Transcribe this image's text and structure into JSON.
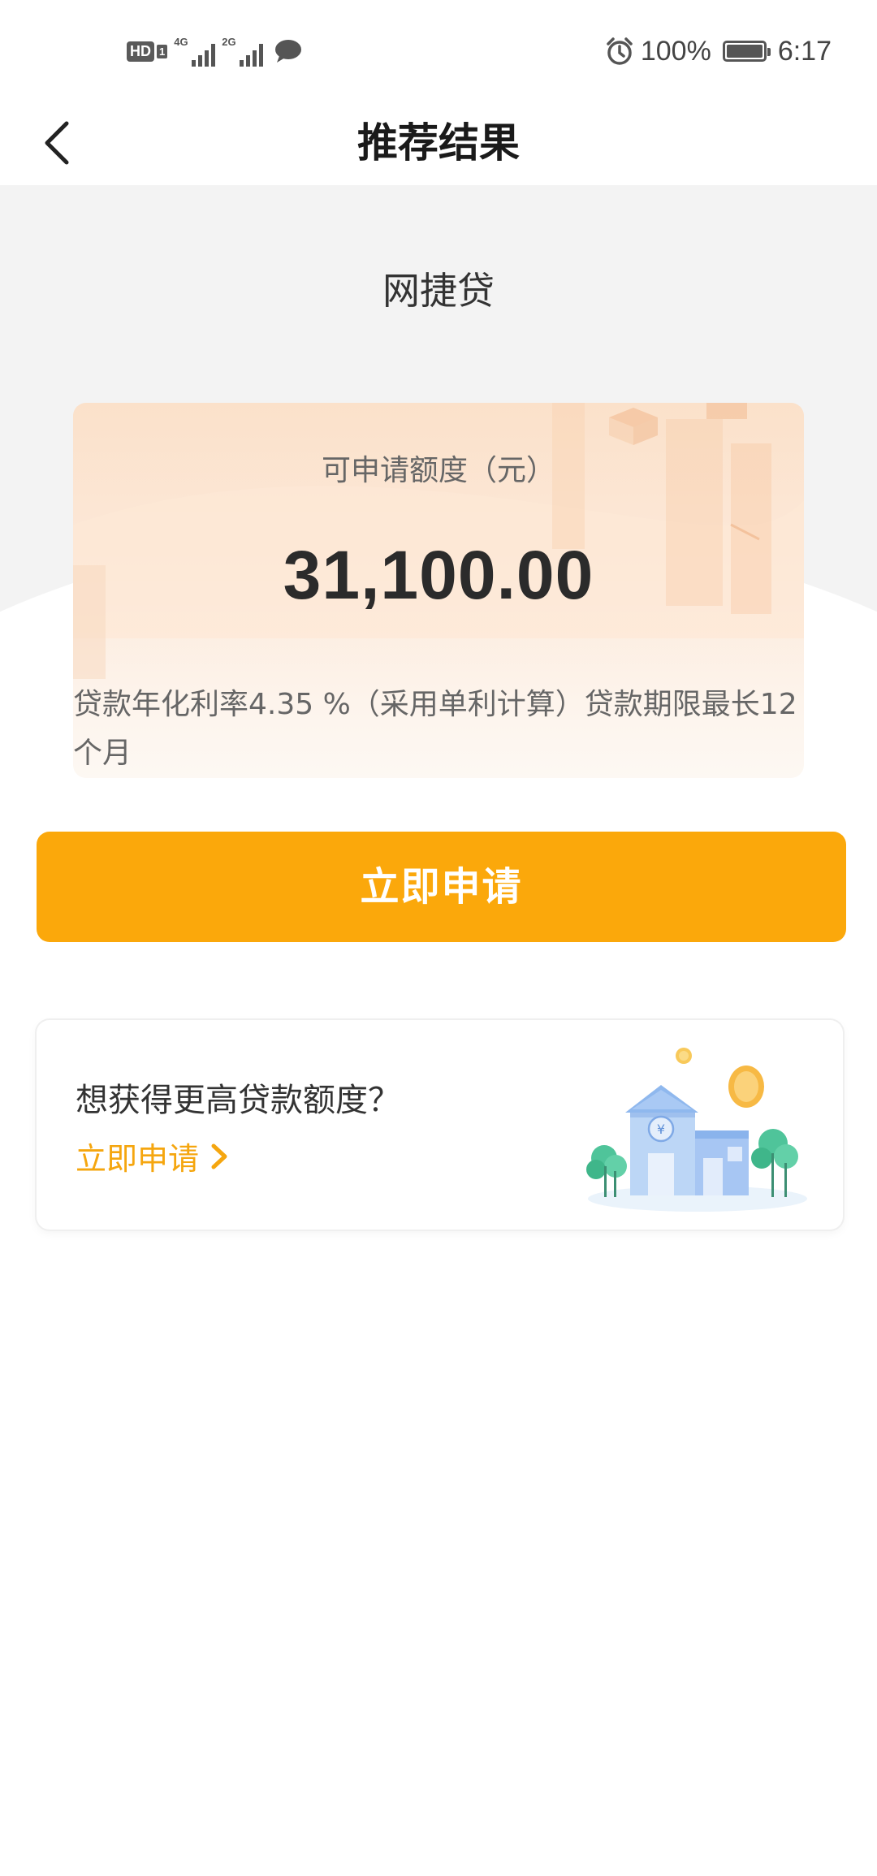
{
  "status_bar": {
    "hd_label": "HD",
    "hd_sub": "1",
    "net1_label": "4G",
    "net2_label": "2G",
    "battery_text": "100%",
    "battery_level": 1.0,
    "time": "6:17"
  },
  "header": {
    "title": "推荐结果"
  },
  "product": {
    "name": "网捷贷"
  },
  "quota": {
    "label": "可申请额度（元）",
    "amount": "31,100.00",
    "note": "贷款年化利率4.35 %（采用单利计算）贷款期限最长12个月"
  },
  "apply_button": {
    "label": "立即申请"
  },
  "promo": {
    "title": "想获得更高贷款额度？",
    "link_label": "立即申请"
  },
  "colors": {
    "accent": "#fba80b",
    "link": "#f5a60f",
    "card_top": "#fbe1ca",
    "card_bottom": "#fdf8f3"
  },
  "icons": {
    "back": "back-arrow-icon",
    "alarm": "alarm-icon",
    "chat": "chat-bubble-icon",
    "battery": "battery-icon",
    "chevron": "chevron-right-icon"
  }
}
